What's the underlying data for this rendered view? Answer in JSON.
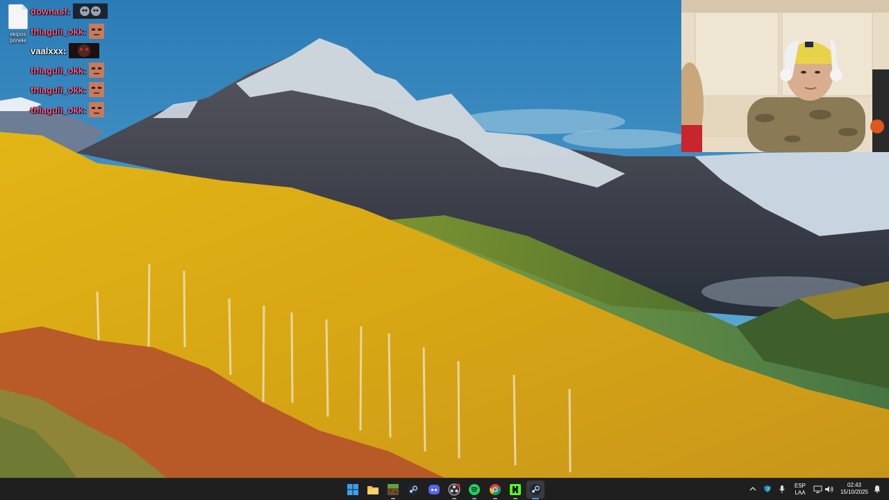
{
  "desktop": {
    "icons": [
      {
        "label_line1": "ekipos",
        "label_line2": "ponele"
      }
    ]
  },
  "chat": {
    "messages": [
      {
        "user": "downasf:",
        "color": "#ff5f8f",
        "emote": "twin-faces-emote"
      },
      {
        "user": "thiaguii_okk:",
        "color": "#ff5f8f",
        "emote": "face-emote"
      },
      {
        "user": "vaalxxx:",
        "color": "#ffffff",
        "emote": "red-eyes-emote"
      },
      {
        "user": "thiaguii_okk:",
        "color": "#ff5f8f",
        "emote": "face-emote"
      },
      {
        "user": "thiaguii_okk:",
        "color": "#ff5f8f",
        "emote": "face-emote"
      },
      {
        "user": "thiaguii_okk:",
        "color": "#ff5f8f",
        "emote": "face-emote"
      }
    ]
  },
  "taskbar": {
    "apps": [
      {
        "name": "start-button-icon"
      },
      {
        "name": "file-explorer-icon"
      },
      {
        "name": "minecraft-launcher-icon"
      },
      {
        "name": "steam-icon"
      },
      {
        "name": "discord-icon"
      },
      {
        "name": "obs-studio-icon"
      },
      {
        "name": "spotify-icon"
      },
      {
        "name": "chrome-icon"
      },
      {
        "name": "kick-icon"
      },
      {
        "name": "steam-active-icon"
      }
    ],
    "tray": {
      "language_top": "ESP",
      "language_bottom": "LAA",
      "time": "02:43",
      "date": "15/10/2025"
    },
    "colors": {
      "background": "#1f1f1f",
      "windows_blue": "#3aa0f0",
      "spotify_green": "#1ed760",
      "kick_green": "#53fc18",
      "discord_blurple": "#5865f2"
    }
  }
}
